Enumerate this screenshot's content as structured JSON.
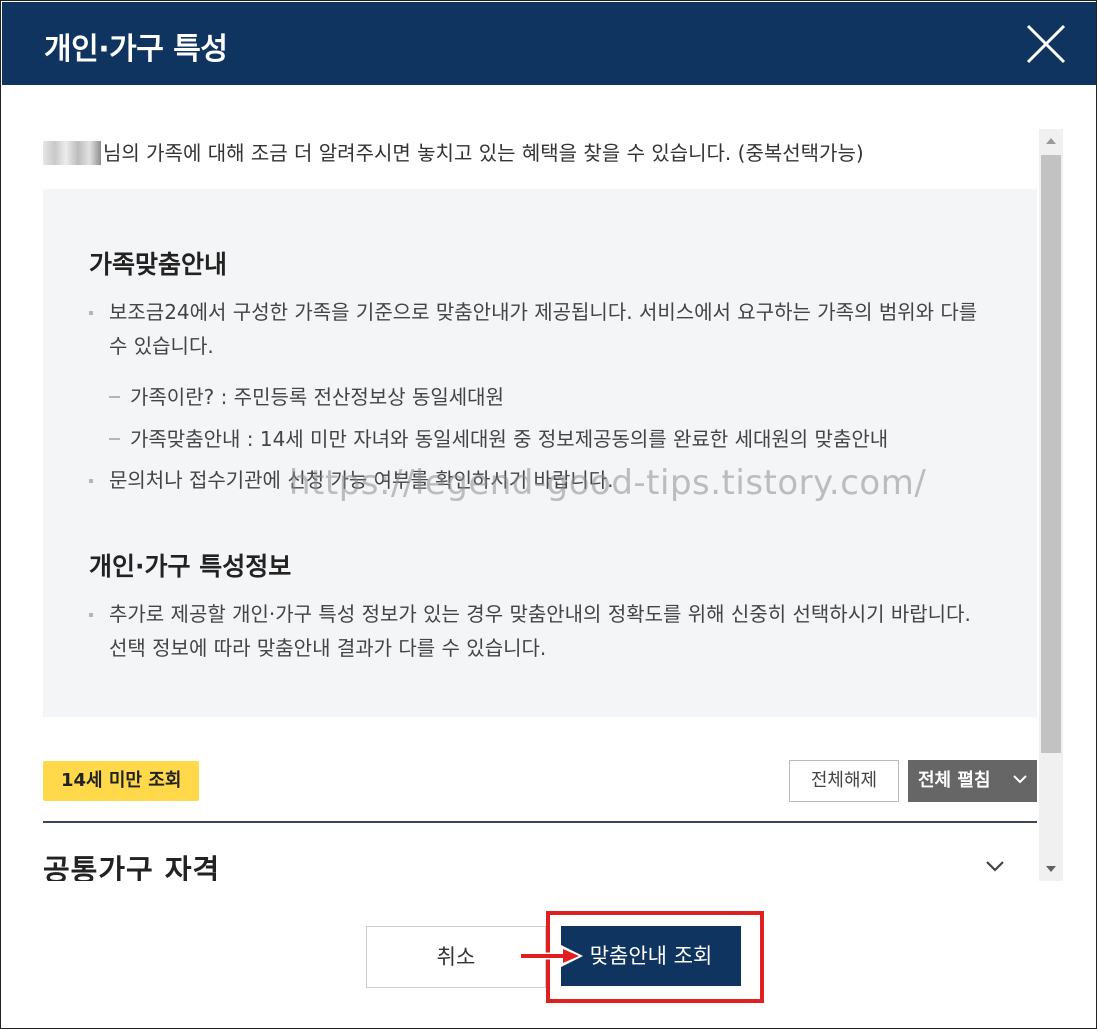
{
  "dialog": {
    "title": "개인·가구 특성",
    "close_icon": "close-icon"
  },
  "intro": {
    "text": "님의 가족에 대해 조금 더 알려주시면 놓치고 있는 혜택을 찾을 수 있습니다. (중복선택가능)"
  },
  "guide": {
    "section1": {
      "heading": "가족맞춤안내",
      "bullet1": "보조금24에서 구성한 가족을 기준으로 맞춤안내가 제공됩니다. 서비스에서 요구하는 가족의 범위와 다를 수 있습니다.",
      "sub1": "가족이란? : 주민등록 전산정보상 동일세대원",
      "sub2": "가족맞춤안내 : 14세 미만 자녀와 동일세대원 중 정보제공동의를 완료한 세대원의 맞춤안내",
      "bullet2": "문의처나 접수기관에 신청 가능 여부를 확인하시기 바랍니다."
    },
    "section2": {
      "heading": "개인·가구 특성정보",
      "bullet1": "추가로 제공할 개인·가구 특성 정보가 있는 경우 맞춤안내의 정확도를 위해 신중히 선택하시기 바랍니다. 선택 정보에 따라 맞춤안내 결과가 다를 수 있습니다."
    }
  },
  "watermark": "https://legend-good-tips.tistory.com/",
  "toolbar": {
    "badge": "14세 미만 조회",
    "deselect_all": "전체해제",
    "expand_all": "전체 펼침"
  },
  "accordion": {
    "label": "공통가구 자격"
  },
  "footer": {
    "cancel": "취소",
    "submit": "맞춤안내 조회"
  },
  "colors": {
    "header": "#0f3460",
    "badge": "#ffd94a",
    "expand_button": "#666666",
    "highlight": "#e02020"
  }
}
